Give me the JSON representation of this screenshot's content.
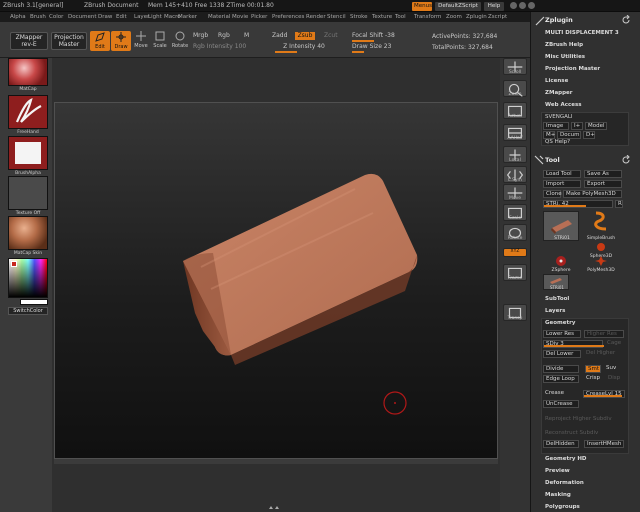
{
  "titlebar": {
    "app": "ZBrush 3.1[general]",
    "doc": "ZBrush Document",
    "mem": "Mem 145+410 Free 1338 ZTime 00:01.80",
    "menus_btn": "Menus",
    "script_btn": "DefaultZScript",
    "help_btn": "Help"
  },
  "menubar": [
    "Alpha",
    "Brush",
    "Color",
    "Document",
    "Draw",
    "Edit",
    "Layer",
    "Light",
    "Macro",
    "Marker",
    "Material",
    "Movie",
    "Picker",
    "Preferences",
    "Render",
    "Stencil",
    "Stroke",
    "Texture",
    "Tool",
    "Transform",
    "Zoom",
    "Zplugin",
    "Zscript"
  ],
  "shelf": {
    "zmapper": "ZMapper",
    "zmapper_sub": "rev-E",
    "projection": "Projection",
    "master": "Master",
    "edit": "Edit",
    "draw": "Draw",
    "move": "Move",
    "scale": "Scale",
    "rotate": "Rotate",
    "mrgb": "Mrgb",
    "rgb": "Rgb",
    "m": "M",
    "rgb_intensity": "Rgb Intensity 100",
    "zadd": "Zadd",
    "zsub": "Zsub",
    "zcut": "Zcut",
    "z_intensity": "Z Intensity 40",
    "focal_shift": "Focal Shift -38",
    "draw_size": "Draw Size 23",
    "active_points": "ActivePoints: 327,684",
    "total_points": "TotalPoints: 327,684"
  },
  "lefttray": {
    "matcap": "MatCap",
    "freehand": "FreeHand",
    "brushalpha": "BrushAlpha",
    "texture": "Texture Off",
    "material": "MatCap Skin",
    "switchcolor": "SwitchColor"
  },
  "rightcol": [
    "Scroll",
    "Zoom",
    "Actual",
    "AAHalf",
    "Local",
    "L.Sym",
    "Move",
    "Scale",
    "Rotate",
    "XYZ",
    "Frame",
    "Transp"
  ],
  "palette": {
    "zplugin_title": "Zplugin",
    "multi_displacement": "MULTI DISPLACEMENT 3",
    "zbrush_help": "ZBrush Help",
    "misc_utilities": "Misc Utilities",
    "projection_master": "Projection Master",
    "license": "License",
    "zmapper": "ZMapper",
    "web_access": "Web Access",
    "svengali": "SVENGALI",
    "image": "Image",
    "i_plus": "I+",
    "model": "Model",
    "m_plus": "M+",
    "docum": "Docum",
    "d_plus": "D+",
    "qs_help": "QS Help?",
    "tool_title": "Tool",
    "load_tool": "Load Tool",
    "save_as": "Save As",
    "import": "Import",
    "export": "Export",
    "clone": "Clone",
    "make_polymesh": "Make PolyMesh3D",
    "stri_value": "STRi. 42",
    "r_btn": "R",
    "tools": [
      "STRi01",
      "SimpleBrush",
      "Sphere3D",
      "ZSphere",
      "PolyMesh3D",
      "STRi01"
    ],
    "subtool": "SubTool",
    "layers": "Layers",
    "geometry": "Geometry",
    "lower_res": "Lower Res",
    "higher_res": "Higher Res",
    "sdiv": "SDiv 3",
    "cage": "Cage",
    "del_lower": "Del Lower",
    "del_higher": "Del Higher",
    "divide": "Divide",
    "smt": "Smt",
    "suv": "Suv",
    "edge_loop": "Edge Loop",
    "crisp": "Crisp",
    "disp": "Disp",
    "crease": "Crease",
    "crease_lvl": "CreaseLvl 15",
    "uncrease": "UnCrease",
    "reproject": "Reproject Higher Subdiv",
    "reconstruct": "Reconstruct Subdiv",
    "delhidden": "DelHidden",
    "inserthmesh": "InsertHMesh",
    "geometry_hd": "Geometry HD",
    "preview": "Preview",
    "deformation": "Deformation",
    "masking": "Masking",
    "polygroups": "Polygroups"
  },
  "colors": {
    "accent": "#e07a18",
    "model": "#b86f55",
    "brush_cursor": "#b01818"
  }
}
